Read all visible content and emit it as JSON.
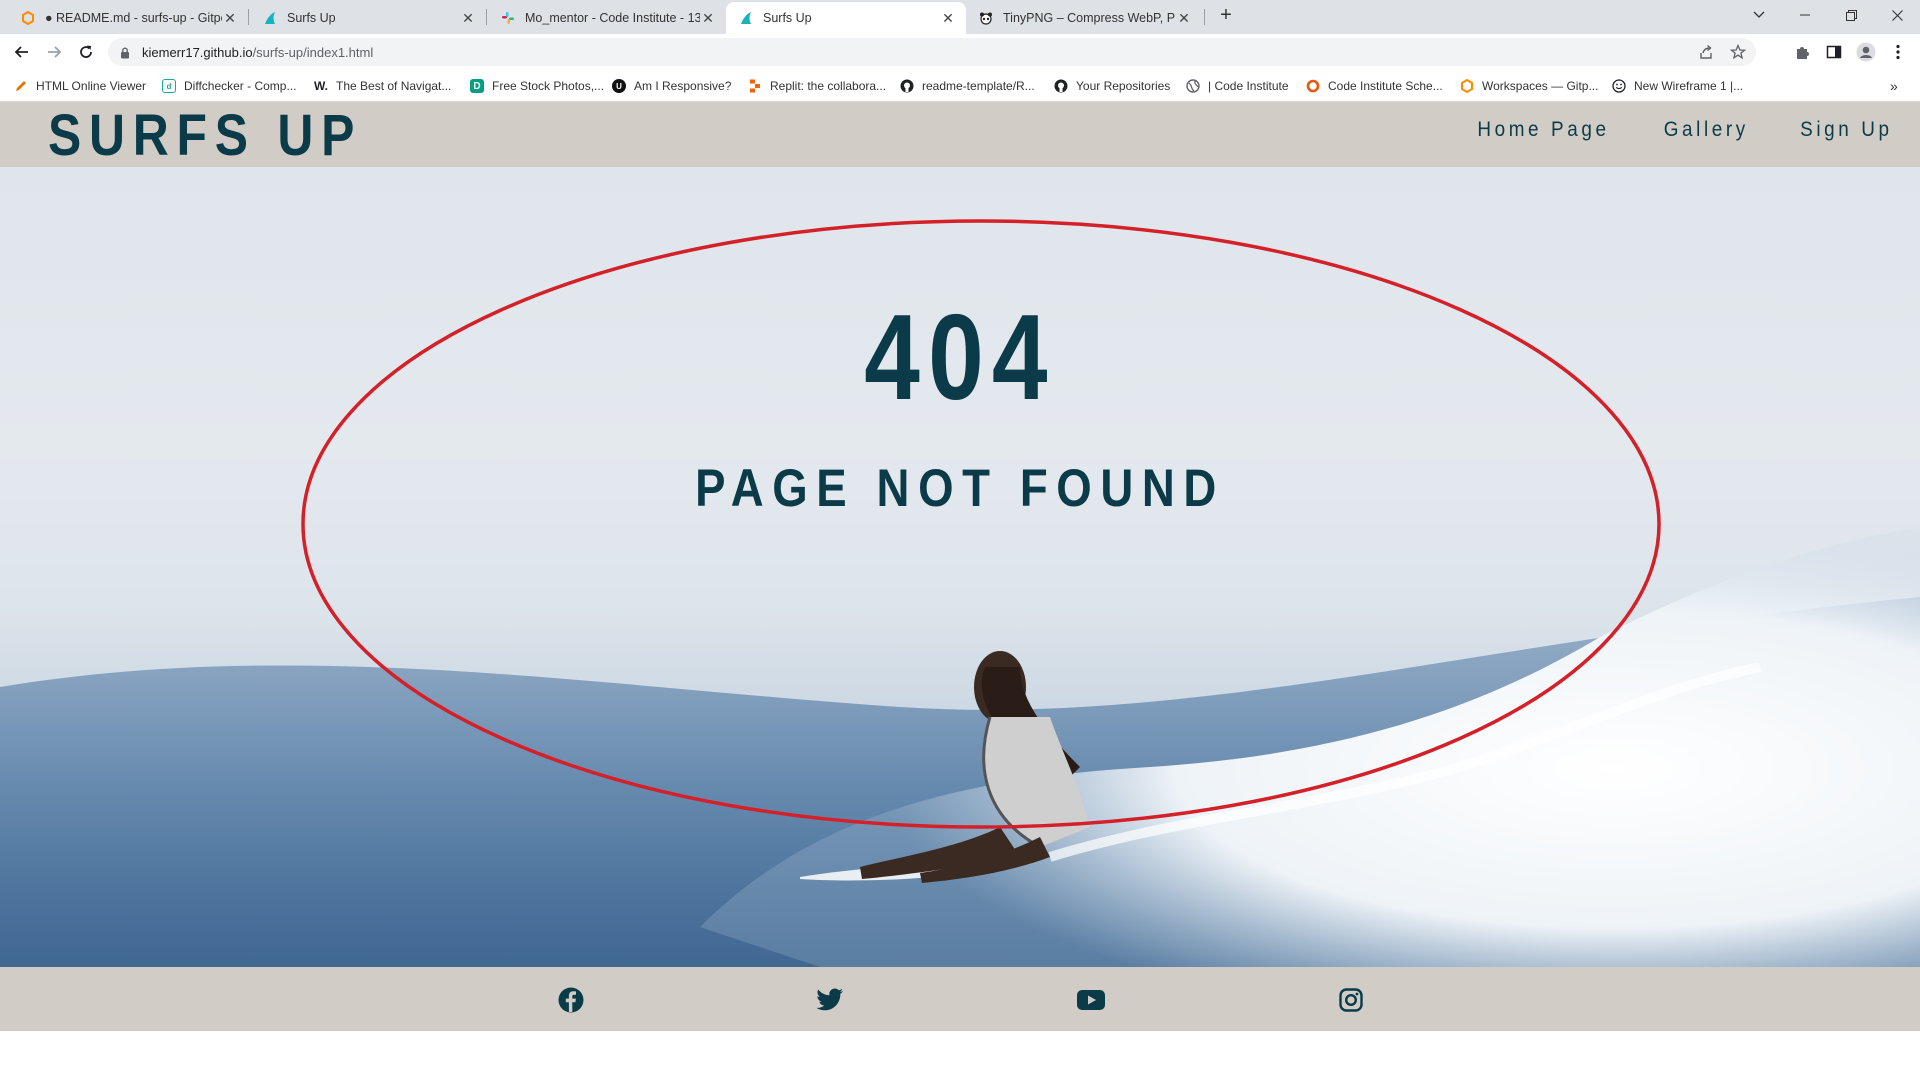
{
  "browser": {
    "tabs": [
      {
        "title": "● README.md - surfs-up - Gitpod",
        "favicon": "gitpod-icon",
        "active": false
      },
      {
        "title": "Surfs Up",
        "favicon": "surfs-up-fin-icon",
        "active": false
      },
      {
        "title": "Mo_mentor - Code Institute - 13",
        "favicon": "slack-icon",
        "active": false
      },
      {
        "title": "Surfs Up",
        "favicon": "surfs-up-fin-icon",
        "active": true
      },
      {
        "title": "TinyPNG – Compress WebP, PNG",
        "favicon": "panda-icon",
        "active": false
      }
    ],
    "url_host": "kiemerr17.github.io",
    "url_path": "/surfs-up/index1.html",
    "bookmarks": [
      {
        "label": "HTML Online Viewer",
        "icon": "pen-icon",
        "color": "#e37400"
      },
      {
        "label": "Diffchecker - Comp...",
        "icon": "diffchecker-icon",
        "color": "#18a999"
      },
      {
        "label": "The Best of Navigat...",
        "icon": "w-icon",
        "color": "#202124"
      },
      {
        "label": "Free Stock Photos,...",
        "icon": "d-icon",
        "color": "#05a081"
      },
      {
        "label": "Am I Responsive?",
        "icon": "ui-icon",
        "color": "#202124"
      },
      {
        "label": "Replit: the collabora...",
        "icon": "replit-icon",
        "color": "#f26207"
      },
      {
        "label": "readme-template/R...",
        "icon": "github-icon",
        "color": "#202124"
      },
      {
        "label": "Your Repositories",
        "icon": "github-icon",
        "color": "#202124"
      },
      {
        "label": "| Code Institute",
        "icon": "globe-icon",
        "color": "#5f6368"
      },
      {
        "label": "Code Institute Sche...",
        "icon": "ring-icon",
        "color": "#e8590c"
      },
      {
        "label": "Workspaces — Gitp...",
        "icon": "gitpod-icon",
        "color": "#ff8a00"
      },
      {
        "label": "New Wireframe 1 |...",
        "icon": "smiley-icon",
        "color": "#202124"
      }
    ],
    "overflow_label": "»"
  },
  "site": {
    "logo": "SURFS UP",
    "nav": [
      "Home Page",
      "Gallery",
      "Sign Up"
    ],
    "error_code": "404",
    "error_message": "PAGE NOT FOUND",
    "social": [
      "facebook-icon",
      "twitter-icon",
      "youtube-icon",
      "instagram-icon"
    ]
  },
  "colors": {
    "brand": "#0b3b48",
    "header_bg": "#d1ccc6",
    "annotation": "#d42028"
  }
}
